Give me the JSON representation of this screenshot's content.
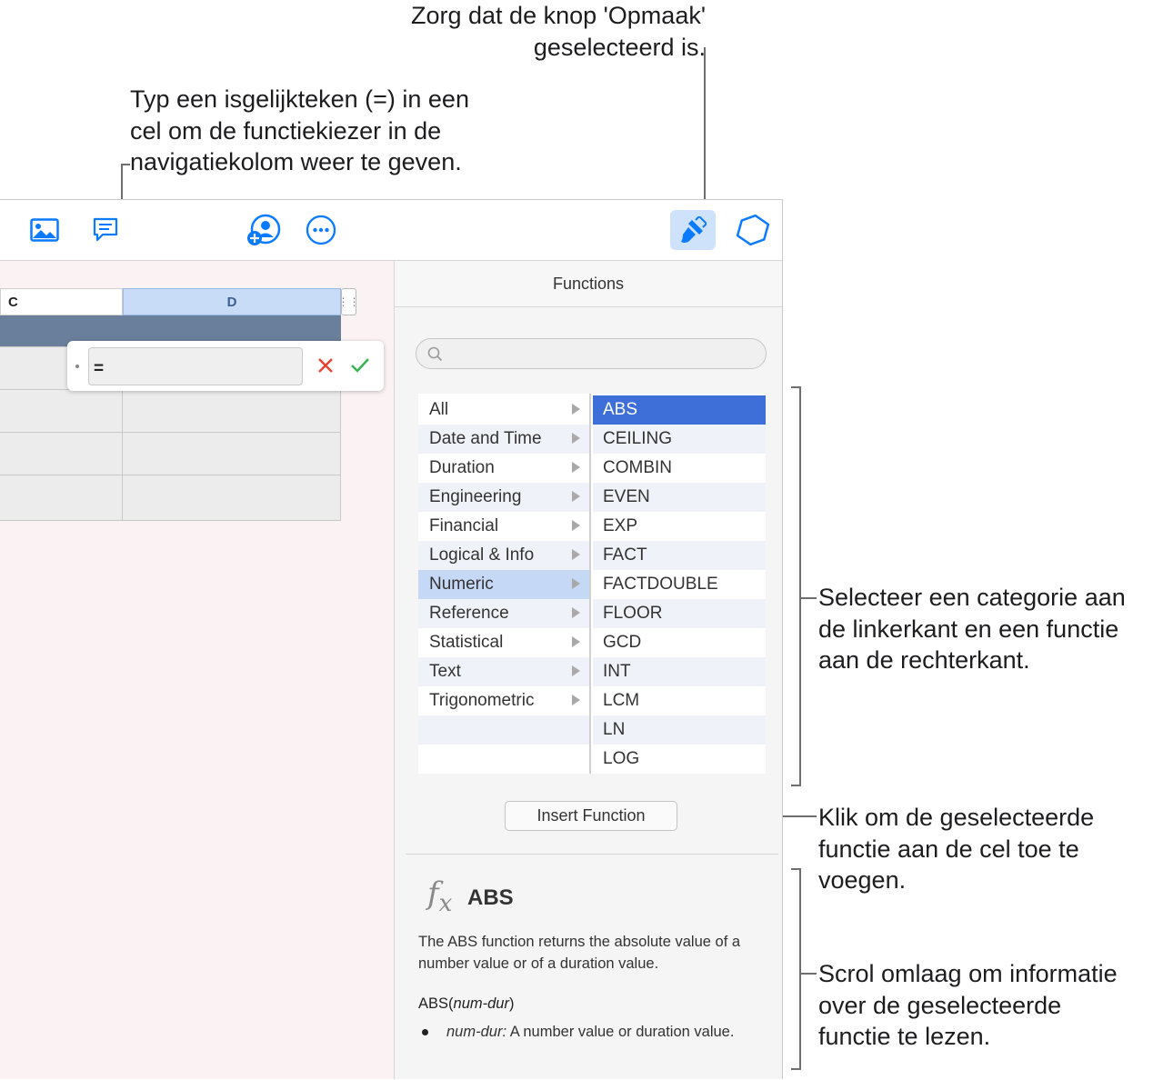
{
  "callouts": {
    "top_right": [
      "Zorg dat de knop 'Opmaak'",
      "geselecteerd is."
    ],
    "top_middle": [
      "Typ een isgelijkteken (=) in een",
      "cel om de functiekiezer in de",
      "navigatiekolom weer te geven."
    ],
    "select": [
      "Selecteer een categorie aan",
      "de linkerkant en een functie",
      "aan de rechterkant."
    ],
    "insert": [
      "Klik om de geselecteerde",
      "functie aan de cel toe te",
      "voegen."
    ],
    "scroll": [
      "Scrol omlaag om informatie",
      "over de geselecteerde",
      "functie te lezen."
    ]
  },
  "toolbar": {
    "icons": [
      "image-icon",
      "comment-icon",
      "collaborate-icon",
      "more-icon",
      "format-brush-icon",
      "organize-icon"
    ],
    "accent": "#0a7aff",
    "selected_bg": "#cfe2fb"
  },
  "sheet": {
    "columns": [
      "C",
      "D"
    ],
    "formula_value": "="
  },
  "sidebar": {
    "title": "Functions",
    "search_placeholder": "",
    "categories": [
      "All",
      "Date and Time",
      "Duration",
      "Engineering",
      "Financial",
      "Logical & Info",
      "Numeric",
      "Reference",
      "Statistical",
      "Text",
      "Trigonometric"
    ],
    "selected_category": "Numeric",
    "functions": [
      "ABS",
      "CEILING",
      "COMBIN",
      "EVEN",
      "EXP",
      "FACT",
      "FACTDOUBLE",
      "FLOOR",
      "GCD",
      "INT",
      "LCM",
      "LN",
      "LOG"
    ],
    "selected_function": "ABS",
    "insert_button": "Insert Function",
    "description": {
      "name": "ABS",
      "text": "The ABS function returns the absolute value of a number value or of a duration value.",
      "syntax_name": "ABS",
      "syntax_args": "num-dur",
      "arg_name": "num-dur:",
      "arg_text": " A number value or duration value."
    }
  },
  "colors": {
    "selected_function_bg": "#3e6fd8",
    "selected_category_bg": "#c5d8f5",
    "column_selected_bg": "#c9dcf7",
    "row_header_bg": "#6a7f9b",
    "cancel": "#e8412f",
    "accept": "#34b34a"
  }
}
